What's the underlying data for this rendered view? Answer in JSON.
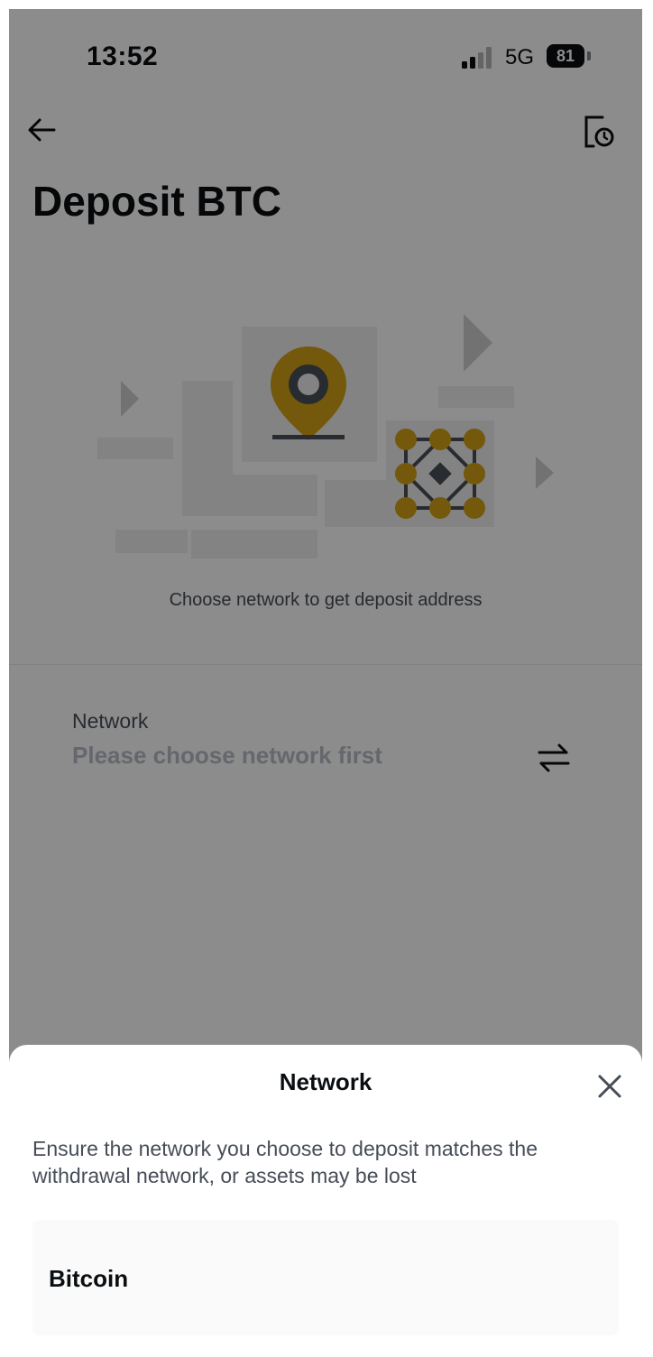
{
  "status_bar": {
    "time": "13:52",
    "network": "5G",
    "battery": "81"
  },
  "header": {
    "title": "Deposit BTC"
  },
  "main": {
    "hint": "Choose network to get deposit address",
    "network_field": {
      "label": "Network",
      "placeholder": "Please choose network first"
    }
  },
  "sheet": {
    "title": "Network",
    "warning": "Ensure the network you choose to deposit matches the withdrawal network, or assets may be lost",
    "options": [
      {
        "label": "Bitcoin"
      }
    ]
  },
  "colors": {
    "brand_yellow": "#F0B90B",
    "text_primary": "#0B0E11",
    "text_secondary": "#474D57",
    "overlay": "rgba(0,0,0,0.45)"
  }
}
